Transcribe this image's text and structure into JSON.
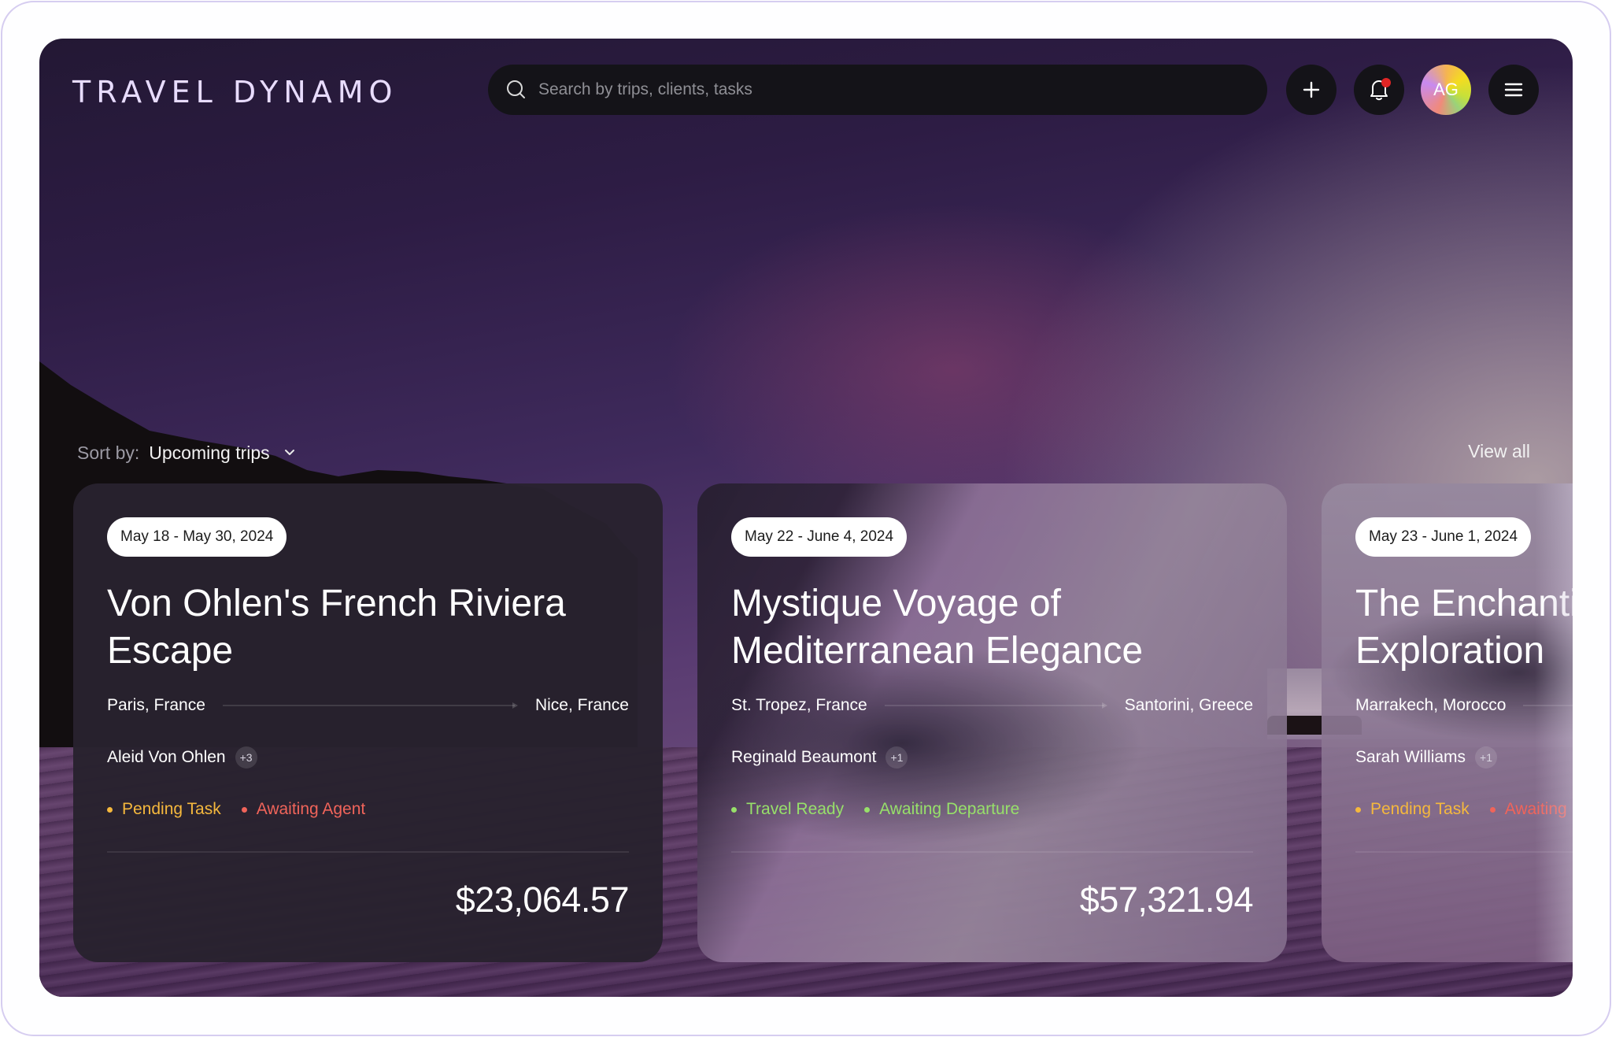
{
  "app": {
    "title": "TRAVEL DYNAMO"
  },
  "header": {
    "search_placeholder": "Search by trips, clients, tasks",
    "search_value": "",
    "add_icon": "plus-icon",
    "notification_icon": "bell-icon",
    "notification_badge": true,
    "avatar_initials": "AG",
    "menu_icon": "hamburger-menu-icon"
  },
  "sort": {
    "label": "Sort by:",
    "value": "Upcoming trips",
    "chevron_icon": "chevron-down-icon"
  },
  "view_all_label": "View all",
  "colors": {
    "pending": "#f5b83d",
    "awaiting_agent": "#f0645a",
    "ready": "#97e06a",
    "notification": "#e02525"
  },
  "trips": [
    {
      "dates": "May 18 - May 30, 2024",
      "title": "Von Ohlen's French Riviera Escape",
      "from": "Paris, France",
      "to": "Nice, France",
      "client": "Aleid Von Ohlen",
      "extra_travelers": "+3",
      "statuses": [
        {
          "label": "Pending Task",
          "color": "#f5b83d"
        },
        {
          "label": "Awaiting Agent",
          "color": "#f0645a"
        }
      ],
      "price": "$23,064.57"
    },
    {
      "dates": "May 22 - June 4, 2024",
      "title": "Mystique Voyage of Mediterranean Elegance",
      "from": "St. Tropez, France",
      "to": "Santorini, Greece",
      "client": "Reginald Beaumont",
      "extra_travelers": "+1",
      "statuses": [
        {
          "label": "Travel Ready",
          "color": "#97e06a"
        },
        {
          "label": "Awaiting Departure",
          "color": "#97e06a"
        }
      ],
      "price": "$57,321.94"
    },
    {
      "dates": "May 23 - June 1, 2024",
      "title": "The Enchanti Exploration",
      "title_line1": "The Enchanti",
      "title_line2": "Exploration",
      "from": "Marrakech, Morocco",
      "client": "Sarah Williams",
      "extra_travelers": "+1",
      "statuses": [
        {
          "label": "Pending Task",
          "color": "#f5b83d"
        },
        {
          "label": "Awaiting",
          "color": "#f0645a"
        }
      ]
    }
  ]
}
